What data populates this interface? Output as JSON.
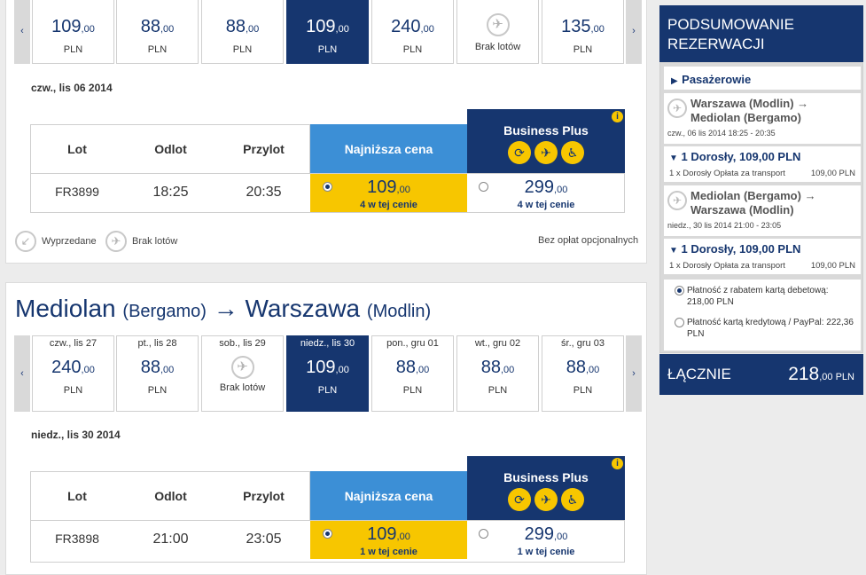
{
  "outbound": {
    "days": [
      {
        "label": "",
        "price": "109",
        "dec": ",00",
        "cur": "PLN",
        "selected": false
      },
      {
        "label": "",
        "price": "88",
        "dec": ",00",
        "cur": "PLN",
        "selected": false
      },
      {
        "label": "",
        "price": "88",
        "dec": ",00",
        "cur": "PLN",
        "selected": false
      },
      {
        "label": "",
        "price": "109",
        "dec": ",00",
        "cur": "PLN",
        "selected": true
      },
      {
        "label": "",
        "price": "240",
        "dec": ",00",
        "cur": "PLN",
        "selected": false
      },
      {
        "label": "",
        "none": "Brak lotów"
      },
      {
        "label": "",
        "price": "135",
        "dec": ",00",
        "cur": "PLN",
        "selected": false
      }
    ],
    "date_heading": "czw., lis 06 2014",
    "flight": {
      "number": "FR3899",
      "dep": "18:25",
      "arr": "20:35",
      "low_price": "109",
      "low_dec": ",00",
      "low_count": "4 w tej cenie",
      "bp_price": "299",
      "bp_dec": ",00",
      "bp_count": "4 w tej cenie"
    }
  },
  "table_headers": {
    "lot": "Lot",
    "odlot": "Odlot",
    "przylot": "Przylot",
    "lowest": "Najniższa cena",
    "bp": "Business Plus"
  },
  "legend": {
    "sold": "Wyprzedane",
    "none": "Brak lotów",
    "nofee": "Bez opłat opcjonalnych"
  },
  "return_route": {
    "from": "Mediolan",
    "from_sub": "(Bergamo)",
    "arrow": "→",
    "to": "Warszawa",
    "to_sub": "(Modlin)"
  },
  "inbound": {
    "days": [
      {
        "label": "czw., lis 27",
        "price": "240",
        "dec": ",00",
        "cur": "PLN",
        "selected": false
      },
      {
        "label": "pt., lis 28",
        "price": "88",
        "dec": ",00",
        "cur": "PLN",
        "selected": false
      },
      {
        "label": "sob., lis 29",
        "none": "Brak lotów"
      },
      {
        "label": "niedz., lis 30",
        "price": "109",
        "dec": ",00",
        "cur": "PLN",
        "selected": true
      },
      {
        "label": "pon., gru 01",
        "price": "88",
        "dec": ",00",
        "cur": "PLN",
        "selected": false
      },
      {
        "label": "wt., gru 02",
        "price": "88",
        "dec": ",00",
        "cur": "PLN",
        "selected": false
      },
      {
        "label": "śr., gru 03",
        "price": "88",
        "dec": ",00",
        "cur": "PLN",
        "selected": false
      }
    ],
    "date_heading": "niedz., lis 30 2014",
    "flight": {
      "number": "FR3898",
      "dep": "21:00",
      "arr": "23:05",
      "low_price": "109",
      "low_dec": ",00",
      "low_count": "1 w tej cenie",
      "bp_price": "299",
      "bp_dec": ",00",
      "bp_count": "1 w tej cenie"
    }
  },
  "summary": {
    "title": "PODSUMOWANIE REZERWACJI",
    "passengers": "Pasażerowie",
    "leg1": {
      "route": "Warszawa (Modlin) → Mediolan (Bergamo)",
      "when": "czw., 06 lis 2014 18:25 - 20:35",
      "pax": "1 Dorosły, 109,00 PLN",
      "fee_label": "1 x Dorosły Opłata za transport",
      "fee": "109,00 PLN"
    },
    "leg2": {
      "route": "Mediolan (Bergamo) → Warszawa (Modlin)",
      "when": "niedz., 30 lis 2014 21:00 - 23:05",
      "pax": "1 Dorosły, 109,00 PLN",
      "fee_label": "1 x Dorosły Opłata za transport",
      "fee": "109,00 PLN"
    },
    "pay1": "Płatność z rabatem kartą debetową: 218,00 PLN",
    "pay2": "Płatność kartą kredytową / PayPal: 222,36 PLN",
    "total_label": "ŁĄCZNIE",
    "total": "218",
    "total_dec": ",00 PLN"
  }
}
